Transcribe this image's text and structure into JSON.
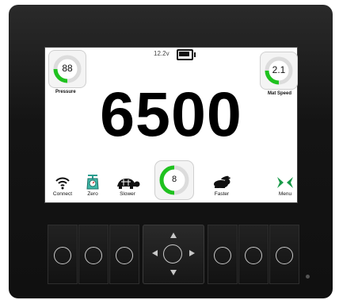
{
  "status": {
    "voltage": "12.2v",
    "battery_icon": "battery-icon"
  },
  "gauges": {
    "pressure": {
      "value": "88",
      "label": "Pressure",
      "fill_fraction": 0.25
    },
    "mat_speed": {
      "value": "2.1",
      "label": "Mat Speed",
      "fill_fraction": 0.25
    },
    "center": {
      "value": "8",
      "fill_fraction": 0.4
    }
  },
  "main_value": "6500",
  "bottom_buttons": {
    "connect": {
      "label": "Connect",
      "icon": "wifi-icon"
    },
    "zero": {
      "label": "Zero",
      "icon": "scale-icon"
    },
    "slower": {
      "label": "Slower",
      "icon": "turtle-icon"
    },
    "faster": {
      "label": "Faster",
      "icon": "rabbit-icon"
    },
    "menu": {
      "label": "Menu",
      "icon": "menu-arrows-icon"
    }
  },
  "colors": {
    "accent": "#1fc21f",
    "screen_bg": "#ffffff",
    "device_bg": "#1a1a1a"
  }
}
